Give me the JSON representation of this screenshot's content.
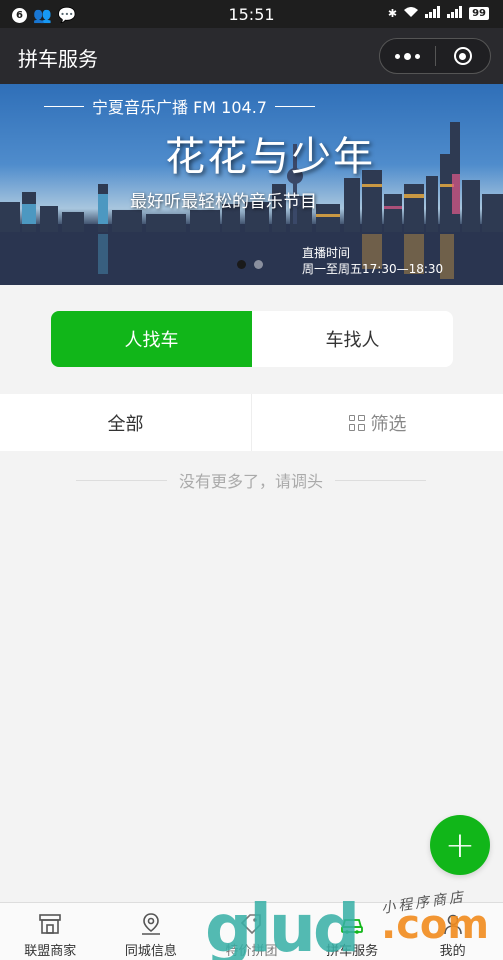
{
  "status_bar": {
    "notif_count": "6",
    "time": "15:51",
    "battery": "99"
  },
  "nav": {
    "title": "拼车服务"
  },
  "banner": {
    "radio": "宁夏音乐广播 FM 104.7",
    "title": "花花与少年",
    "subtitle": "最好听最轻松的音乐节目",
    "live_label": "直播时间",
    "live_time": "周一至周五17:30—18:30"
  },
  "toggle": {
    "options": [
      "人找车",
      "车找人"
    ],
    "active_index": 0
  },
  "filters": {
    "all_label": "全部",
    "filter_label": "筛选"
  },
  "list": {
    "end_text": "没有更多了，请调头"
  },
  "fab": {
    "label": "+"
  },
  "tabbar": {
    "items": [
      {
        "label": "联盟商家",
        "icon": "store-icon"
      },
      {
        "label": "同城信息",
        "icon": "location-pin-icon"
      },
      {
        "label": "特价拼团",
        "icon": "tag-icon"
      },
      {
        "label": "拼车服务",
        "icon": "car-icon"
      },
      {
        "label": "我的",
        "icon": "user-icon"
      }
    ]
  },
  "watermark": {
    "text_main": "glud",
    "text_tld": ".com",
    "text_cn": "小程序商店"
  },
  "colors": {
    "accent": "#11b619",
    "nav_bg": "#2a2a2e"
  }
}
